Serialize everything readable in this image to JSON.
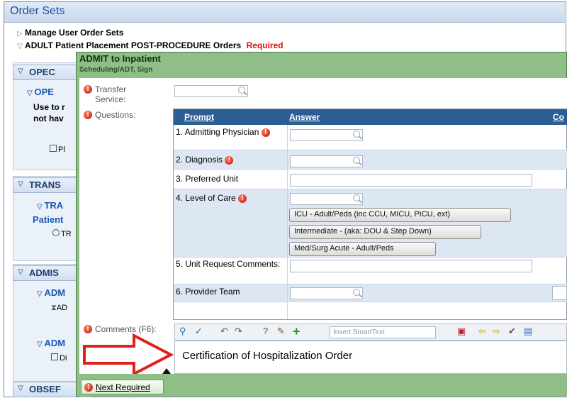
{
  "window": {
    "title": "Order Sets",
    "manage_user_order_sets": "Manage User Order Sets",
    "order_set_name": "ADULT Patient Placement POST-PROCEDURE Orders",
    "required_badge": "Required"
  },
  "left_panel": {
    "opec_header": "OPEC",
    "opec_sub": "OPE",
    "use_text_1": "Use to r",
    "use_text_2": "not hav",
    "pl_item": "Pl",
    "trans_header": "TRANS",
    "tra_sub": "TRA",
    "patient_text": "Patient",
    "tr_item": "TR",
    "admis_header": "ADMIS",
    "adm_sub_1": "ADM",
    "ad_item": "AD",
    "adm_sub_2": "ADM",
    "di_item": "Di",
    "obser_header": "OBSEF"
  },
  "dialog": {
    "title": "ADMIT to Inpatient",
    "subtitle": "Scheduling/ADT, Sign",
    "transfer_label": "Transfer Service:",
    "questions_label": "Questions:",
    "comments_label": "Comments (F6):",
    "next_required": "Next Required"
  },
  "grid": {
    "col_prompt": "Prompt",
    "col_answer": "Answer",
    "col_comment": "Co",
    "rows": [
      {
        "prompt": "1. Admitting Physician",
        "required": true
      },
      {
        "prompt": "2. Diagnosis",
        "required": true
      },
      {
        "prompt": "3. Preferred Unit",
        "required": false
      },
      {
        "prompt": "4. Level of Care",
        "required": true
      },
      {
        "prompt": "5. Unit Request Comments:",
        "required": false
      },
      {
        "prompt": "6. Provider Team",
        "required": false
      }
    ],
    "level_of_care_options": [
      "ICU - Adult/Peds (inc CCU, MICU, PICU, ext)",
      "Intermediate - (aka: DOU & Step Down)",
      "Med/Surg Acute - Adult/Peds"
    ]
  },
  "comment_toolbar": {
    "smarttext_placeholder": "Insert SmartText"
  },
  "comment_text": "Certification of Hospitalization Order",
  "colors": {
    "dialog_green": "#8fbf86",
    "grid_header_blue": "#2c5e94",
    "arrow_red": "#e0201a",
    "error_red": "#c0140a"
  }
}
